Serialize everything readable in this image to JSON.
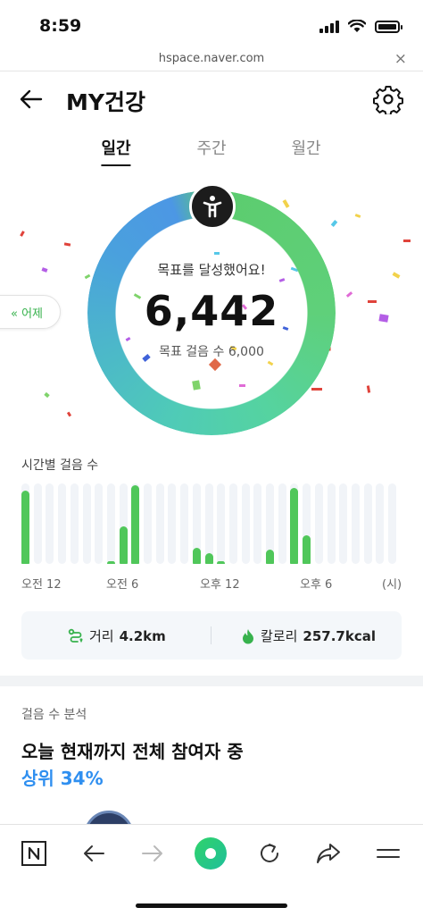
{
  "status_bar": {
    "time": "8:59"
  },
  "browser": {
    "url": "hspace.naver.com",
    "close_label": "×"
  },
  "header": {
    "title": "MY건강"
  },
  "tabs": [
    {
      "label": "일간",
      "active": true
    },
    {
      "label": "주간",
      "active": false
    },
    {
      "label": "월간",
      "active": false
    }
  ],
  "ring": {
    "goal_message": "목표를 달성했어요!",
    "steps": "6,442",
    "goal_label": "목표 걸음 수 6,000",
    "progress": 1.0
  },
  "yesterday_button": "« 어제",
  "hourly": {
    "title": "시간별 걸음 수",
    "axis_labels": [
      "오전 12",
      "오전 6",
      "오후 12",
      "오후 6",
      "(시)"
    ],
    "bars": [
      0.91,
      0,
      0,
      0,
      0,
      0,
      0,
      0.02,
      0.47,
      0.98,
      0,
      0,
      0,
      0,
      0.2,
      0.13,
      0.02,
      0,
      0,
      0,
      0.18,
      0,
      0.95,
      0.36,
      0,
      0,
      0,
      0,
      0,
      0,
      0
    ]
  },
  "chart_data": {
    "type": "bar",
    "title": "시간별 걸음 수",
    "x_tick_labels": [
      "오전 12",
      "오전 6",
      "오후 12",
      "오후 6",
      "(시)"
    ],
    "values_relative": [
      0.91,
      0,
      0,
      0,
      0,
      0,
      0,
      0.02,
      0.47,
      0.98,
      0,
      0,
      0,
      0,
      0.2,
      0.13,
      0.02,
      0,
      0,
      0,
      0.18,
      0,
      0.95,
      0.36,
      0,
      0,
      0,
      0,
      0,
      0,
      0
    ],
    "bar_color": "#50c75a"
  },
  "summary": {
    "distance_label": "거리",
    "distance_value": "4.2km",
    "calorie_label": "칼로리",
    "calorie_value": "257.7kcal"
  },
  "analysis": {
    "label": "걸음 수 분석",
    "title": "오늘 현재까지 전체 참여자 중",
    "rank": "상위 34%"
  },
  "toolbar_icons": [
    "naver-n-icon",
    "back-arrow-icon",
    "forward-arrow-icon",
    "home-circle-icon",
    "refresh-icon",
    "share-icon",
    "menu-icon"
  ],
  "colors": {
    "accent_green": "#50c75a",
    "accent_blue": "#2f8ff0",
    "ring_start": "#4c97e4",
    "ring_end": "#5ccc6e"
  }
}
